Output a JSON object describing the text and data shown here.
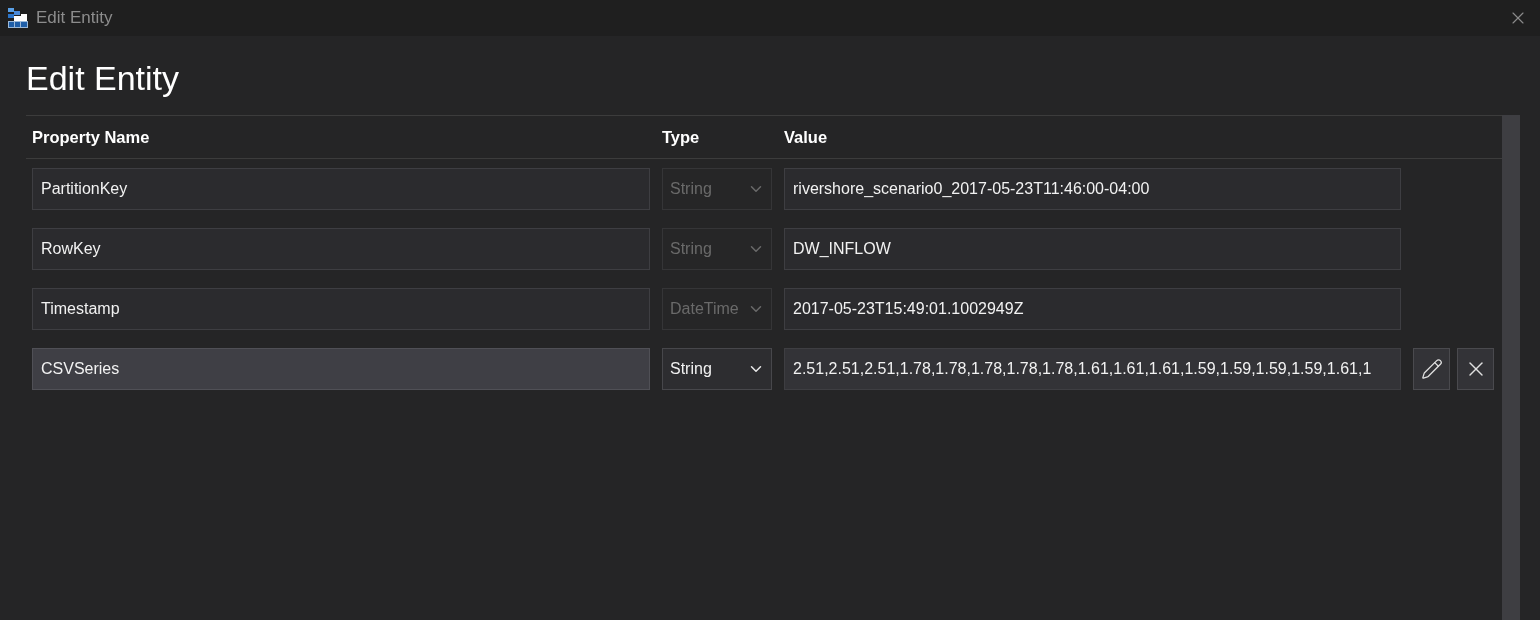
{
  "window": {
    "title": "Edit Entity"
  },
  "heading": "Edit Entity",
  "table": {
    "columns": [
      "Property Name",
      "Type",
      "Value"
    ],
    "rows": [
      {
        "name": "PartitionKey",
        "type": "String",
        "value": "rivershore_scenario0_2017-05-23T11:46:00-04:00",
        "editable": false,
        "focused": false
      },
      {
        "name": "RowKey",
        "type": "String",
        "value": "DW_INFLOW",
        "editable": false,
        "focused": false
      },
      {
        "name": "Timestamp",
        "type": "DateTime",
        "value": "2017-05-23T15:49:01.1002949Z",
        "editable": false,
        "focused": false
      },
      {
        "name": "CSVSeries",
        "type": "String",
        "value": "2.51,2.51,2.51,1.78,1.78,1.78,1.78,1.78,1.61,1.61,1.61,1.59,1.59,1.59,1.59,1.61,1",
        "editable": true,
        "focused": true
      }
    ]
  }
}
